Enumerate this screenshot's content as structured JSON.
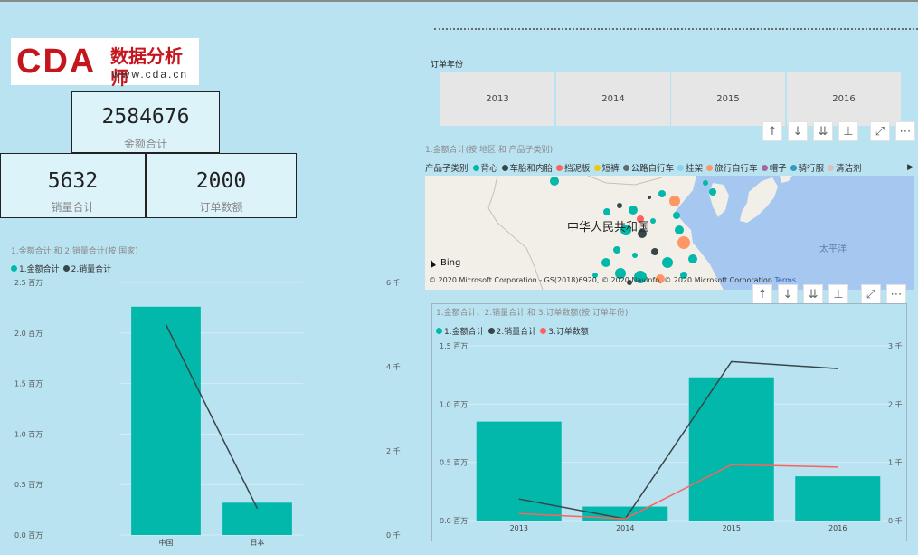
{
  "logo": {
    "text_main": "CDA",
    "text_cn": "数据分析师",
    "url": "www.cda.cn"
  },
  "kpis": [
    {
      "value": "2584676",
      "label": "金额合计"
    },
    {
      "value": "5632",
      "label": "销量合计"
    },
    {
      "value": "2000",
      "label": "订单数额"
    }
  ],
  "slicer": {
    "title": "订单年份",
    "options": [
      "2013",
      "2014",
      "2015",
      "2016"
    ]
  },
  "toolbar": {
    "icons": [
      "arrow-up-icon",
      "arrow-down-icon",
      "double-arrow-down-icon",
      "expand-hierarchy-icon",
      "focus-mode-icon",
      "more-options-icon"
    ]
  },
  "map_visual": {
    "title": "1.金额合计(按 地区 和 产品子类别)",
    "legend_title": "产品子类别",
    "legend_items": [
      {
        "label": "背心",
        "color": "#01b8aa"
      },
      {
        "label": "车胎和内胎",
        "color": "#374649"
      },
      {
        "label": "挡泥板",
        "color": "#fd625e"
      },
      {
        "label": "短裤",
        "color": "#f2c80f"
      },
      {
        "label": "公路自行车",
        "color": "#5f6b6d"
      },
      {
        "label": "挂架",
        "color": "#8ad4eb"
      },
      {
        "label": "旅行自行车",
        "color": "#fe9666"
      },
      {
        "label": "帽子",
        "color": "#a66999"
      },
      {
        "label": "骑行服",
        "color": "#3599b8"
      },
      {
        "label": "清洁剂",
        "color": "#dfbfbf"
      }
    ],
    "country_label": "中华人民共和国",
    "ocean_label": "太平洋",
    "bing_label": "Bing",
    "copyright": "© 2020 Microsoft Corporation - GS(2018)6920, © 2020 NavInfo, © 2020 Microsoft Corporation",
    "terms": "Terms"
  },
  "chart_data": [
    {
      "type": "bar",
      "title": "1.金额合计 和 2.销量合计(按 国家)",
      "categories": [
        "中国",
        "日本"
      ],
      "series": [
        {
          "name": "1.金额合计",
          "kind": "bar",
          "axis": "left",
          "color": "#01b8aa",
          "values": [
            2260000,
            320000
          ]
        },
        {
          "name": "2.销量合计",
          "kind": "line",
          "axis": "right",
          "color": "#374649",
          "values": [
            5000,
            630
          ]
        }
      ],
      "y_left": {
        "ylim": [
          0,
          2500000
        ],
        "ticks": [
          0,
          500000,
          1000000,
          1500000,
          2000000,
          2500000
        ],
        "tick_labels": [
          "0.0 百万",
          "0.5 百万",
          "1.0 百万",
          "1.5 百万",
          "2.0 百万",
          "2.5 百万"
        ]
      },
      "y_right": {
        "ylim": [
          0,
          6000
        ],
        "ticks": [
          0,
          2000,
          4000,
          6000
        ],
        "tick_labels": [
          "0 千",
          "2 千",
          "4 千",
          "6 千"
        ]
      },
      "grid": true,
      "legend": "top-left"
    },
    {
      "type": "bar",
      "title": "1.金额合计、2.销量合计 和 3.订单数额(按 订单年份)",
      "categories": [
        "2013",
        "2014",
        "2015",
        "2016"
      ],
      "series": [
        {
          "name": "1.金额合计",
          "kind": "bar",
          "axis": "left",
          "color": "#01b8aa",
          "values": [
            850000,
            120000,
            1230000,
            380000
          ]
        },
        {
          "name": "2.销量合计",
          "kind": "line",
          "axis": "right",
          "color": "#374649",
          "values": [
            370,
            30,
            2730,
            2610
          ]
        },
        {
          "name": "3.订单数额",
          "kind": "line",
          "axis": "right",
          "color": "#fd625e",
          "values": [
            120,
            30,
            960,
            920
          ]
        }
      ],
      "y_left": {
        "ylim": [
          0,
          1500000
        ],
        "ticks": [
          0,
          500000,
          1000000,
          1500000
        ],
        "tick_labels": [
          "0.0 百万",
          "0.5 百万",
          "1.0 百万",
          "1.5 百万"
        ]
      },
      "y_right": {
        "ylim": [
          0,
          3000
        ],
        "ticks": [
          0,
          1000,
          2000,
          3000
        ],
        "tick_labels": [
          "0 千",
          "1 千",
          "2 千",
          "3 千"
        ]
      },
      "grid": true,
      "legend": "top-left"
    }
  ]
}
